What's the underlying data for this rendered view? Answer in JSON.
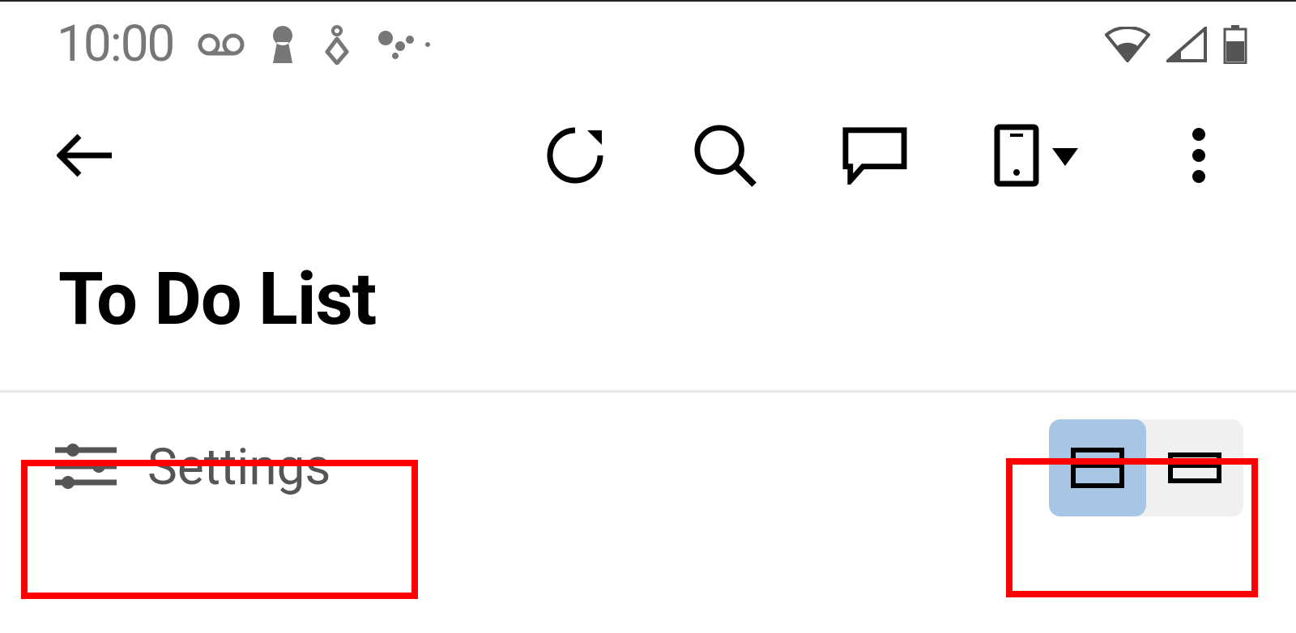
{
  "status": {
    "time": "10:00"
  },
  "page": {
    "title": "To Do List"
  },
  "options": {
    "settings_label": "Settings"
  }
}
